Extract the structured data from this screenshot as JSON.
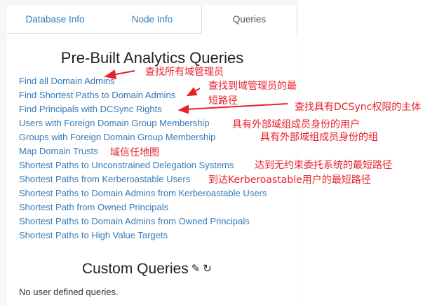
{
  "tabs": {
    "database_info": "Database Info",
    "node_info": "Node Info",
    "queries": "Queries",
    "active": "queries"
  },
  "prebuilt": {
    "title": "Pre-Built Analytics Queries",
    "queries": [
      "Find all Domain Admins",
      "Find Shortest Paths to Domain Admins",
      "Find Principals with DCSync Rights",
      "Users with Foreign Domain Group Membership",
      "Groups with Foreign Domain Group Membership",
      "Map Domain Trusts",
      "Shortest Paths to Unconstrained Delegation Systems",
      "Shortest Paths from Kerberoastable Users",
      "Shortest Paths to Domain Admins from Kerberoastable Users",
      "Shortest Path from Owned Principals",
      "Shortest Paths to Domain Admins from Owned Principals",
      "Shortest Paths to High Value Targets"
    ]
  },
  "custom": {
    "title": "Custom Queries",
    "edit_icon": "pencil-icon",
    "refresh_icon": "refresh-icon",
    "empty_text": "No user defined queries."
  },
  "annotations": {
    "a1": "查找所有域管理员",
    "a2_line1": "查找到域管理员的最",
    "a2_line2": "短路径",
    "a3": "查找具有DCSync权限的主体",
    "a4": "具有外部域组成员身份的用户",
    "a5": "具有外部域组成员身份的组",
    "a6": "域信任地图",
    "a7": "达到无约束委托系统的最短路径",
    "a8": "到达Kerberoastable用户的最短路径"
  },
  "colors": {
    "link": "#337ab7",
    "annotation": "#e8202a",
    "panel_bg": "#f7f7f7"
  }
}
